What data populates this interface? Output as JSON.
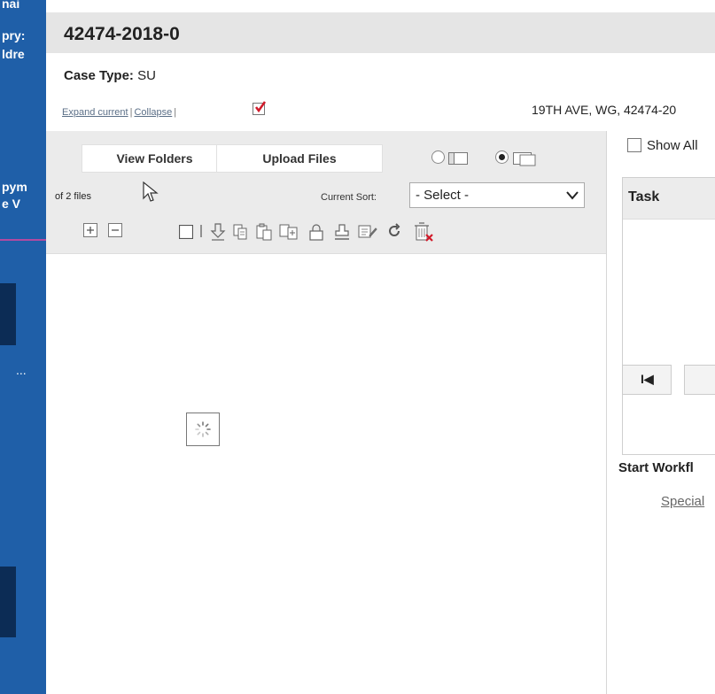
{
  "sidebar": {
    "fragments": [
      "nai",
      "pry:",
      "ldre",
      "pym",
      "e V",
      "..."
    ]
  },
  "case": {
    "number": "42474-2018-0",
    "type_label": "Case Type:",
    "type_value": "SU"
  },
  "links": {
    "expand_current": "Expand current",
    "separator": "|",
    "collapse": "Collapse",
    "separator2": "|"
  },
  "address": "19TH AVE, WG, 42474-20",
  "file_panel": {
    "view_folders_label": "View Folders",
    "upload_files_label": "Upload Files",
    "file_count": "of 2 files",
    "current_sort_label": "Current Sort:",
    "sort_selected": "- Select -"
  },
  "task_panel": {
    "show_all_label": "Show All",
    "task_header": "Task",
    "first_page_glyph": "I◀",
    "start_workflow_label": "Start Workfl",
    "special_link": "Special"
  },
  "icons": {
    "plus_square": "expand-all-icon",
    "minus_square": "collapse-all-icon",
    "select_checkbox": "select-all-checkbox",
    "download": "download-icon",
    "copy": "copy-icon",
    "paste": "paste-icon",
    "merge": "merge-icon",
    "lock": "lock-icon",
    "stamp": "stamp-icon",
    "edit": "edit-icon",
    "refresh": "refresh-icon",
    "delete": "delete-icon"
  },
  "colors": {
    "sidebar_blue": "#1f5fa8",
    "red_check": "#d11a2a",
    "delete_x": "#d11a2a"
  }
}
